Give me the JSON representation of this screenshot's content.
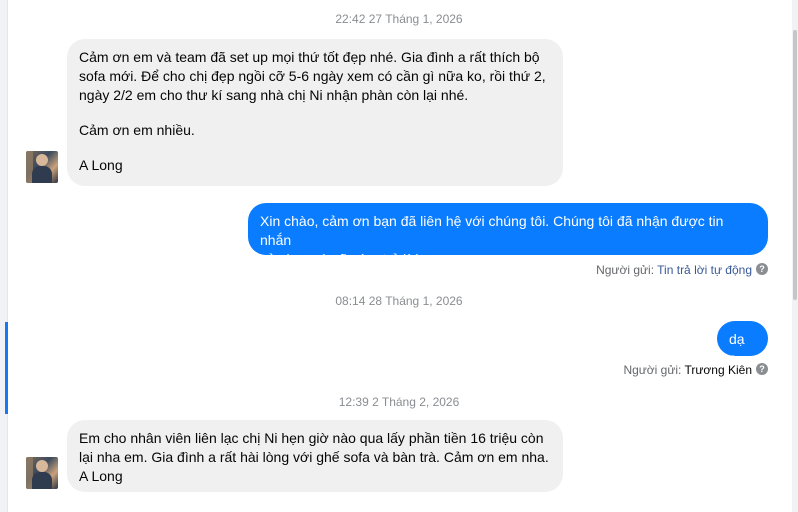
{
  "conversation": {
    "timestamps": [
      "22:42 27 Tháng 1, 2026",
      "08:14 28 Tháng 1, 2026",
      "12:39 2 Tháng 2, 2026"
    ],
    "msg1": {
      "line1": "Cảm ơn em và team đã set up mọi thứ tốt đẹp nhé. Gia đình a rất thích bộ",
      "line2": "sofa mới. Để cho chị đẹp ngồi cỡ 5-6 ngày xem có cần gì nữa ko, rồi thứ 2,",
      "line3": "ngày 2/2 em cho thư kí sang nhà chị Ni nhận phàn còn lại nhé.",
      "line4": "Cảm ơn em nhiều.",
      "line5": "A Long"
    },
    "msg2": {
      "line1": "Xin chào, cảm ơn bạn đã liên hệ với chúng tôi. Chúng tôi đã nhận được tin nhắn",
      "line2": "của bạn và sẽ sớm trả lời.",
      "sender_prefix": "Người gửi: ",
      "sender_name": "Tin trả lời tự động"
    },
    "msg3": {
      "text": "dạ a",
      "sender_prefix": "Người gửi: ",
      "sender_name": "Trương Kiên"
    },
    "msg4": {
      "line1": "Em cho nhân viên liên lạc chị Ni hẹn giờ nào qua lấy phần tiền 16 triệu còn",
      "line2": "lại nha em. Gia đình a rất hài lòng với ghế sofa và bàn trà. Cảm ơn em nha.",
      "line3": "A Long"
    },
    "help_glyph": "?",
    "colors": {
      "outgoing": "#0a7cff",
      "incoming": "#f0f0f0",
      "link": "#385898"
    }
  }
}
